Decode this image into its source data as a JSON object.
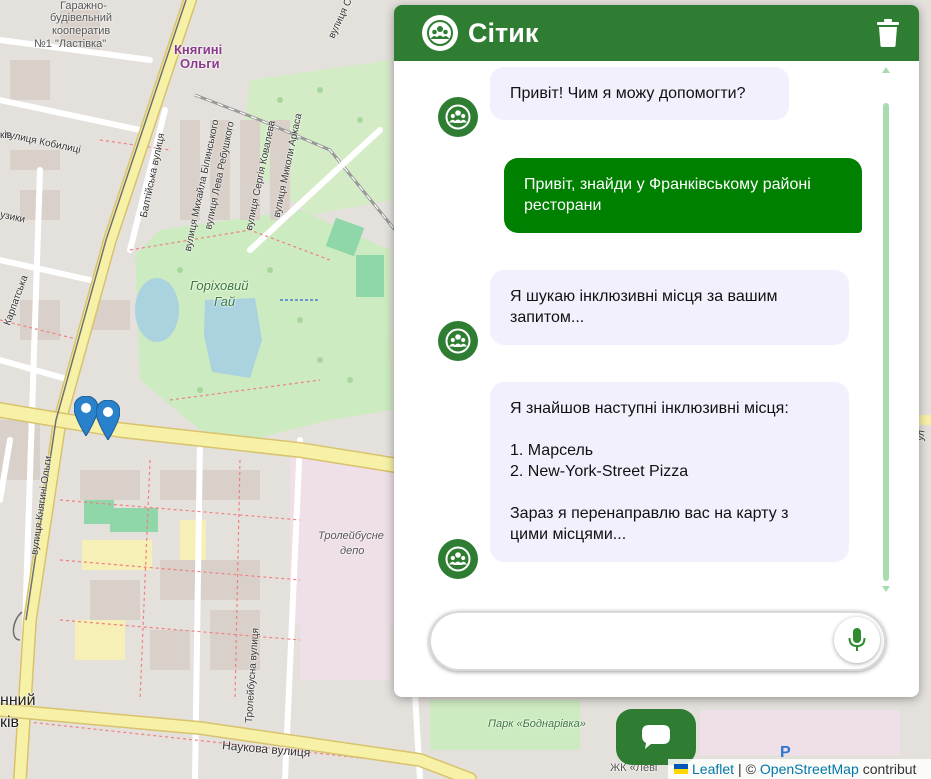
{
  "app": {
    "title": "Сітик",
    "brand_color": "#2e7d32",
    "user_bubble_color": "#008000",
    "bot_bubble_color": "#f3f0fe"
  },
  "header": {
    "logo_icon": "people-group-icon",
    "delete_icon": "trash-icon"
  },
  "messages": [
    {
      "role": "bot",
      "text": "Привіт! Чим я можу допомогти?"
    },
    {
      "role": "user",
      "text": "Привіт, знайди у Франківському районі ресторани"
    },
    {
      "role": "bot",
      "text": "Я шукаю інклюзивні місця за вашим запитом..."
    },
    {
      "role": "bot",
      "lines": [
        "Я знайшов наступні інклюзивні місця:",
        "",
        "1. Марсель",
        "2. New-York-Street Pizza",
        "",
        "Зараз я перенаправлю вас на карту з цими місцями..."
      ]
    }
  ],
  "input": {
    "placeholder": "",
    "value": ""
  },
  "mic_icon": "microphone-icon",
  "fab_icon": "chat-bubble-icon",
  "attribution": {
    "leaflet": "Leaflet",
    "separator": "| ©",
    "osm": "OpenStreetMap",
    "suffix": "contribut"
  },
  "map": {
    "labels": {
      "coop1": "Гаражно-",
      "coop2": "будівельний",
      "coop3": "кооператив",
      "coop4": "№1 \"Ластівка\"",
      "kniahyni1": "Княгині",
      "kniahyni2": "Ольги",
      "park1": "Горіховий",
      "park2": "Гай",
      "street_kniahyni": "вулиця Княгині Ольги",
      "street_baltiiska": "Балтійська вулиця",
      "street_bilynskoho": "вулиця Михайла Білинського",
      "street_rebushkoho": "вулиця Лева Ребушкого",
      "street_kovaleva": "вулиця Сергія Ковалева",
      "street_arkasa": "вулиця Миколи Аркаса",
      "street_kobylytsi": "вулиця Кобилиці",
      "street_muzyky": "узики",
      "street_karpatska": "Карпатська",
      "street_troleibusna": "Тролейбусна вулиця",
      "street_naukova": "Наукова вулиця",
      "street_sil": "вулиця Сил",
      "depot1": "Тролейбусне",
      "depot2": "депо",
      "park_bodnarivka": "Парк «Боднарівка»",
      "zhk": "ЖК «Леві",
      "left_n": "нний",
      "left_kiv": "ків",
      "left_tok": "ків",
      "left_ulic": "ул",
      "parking": "P"
    }
  }
}
